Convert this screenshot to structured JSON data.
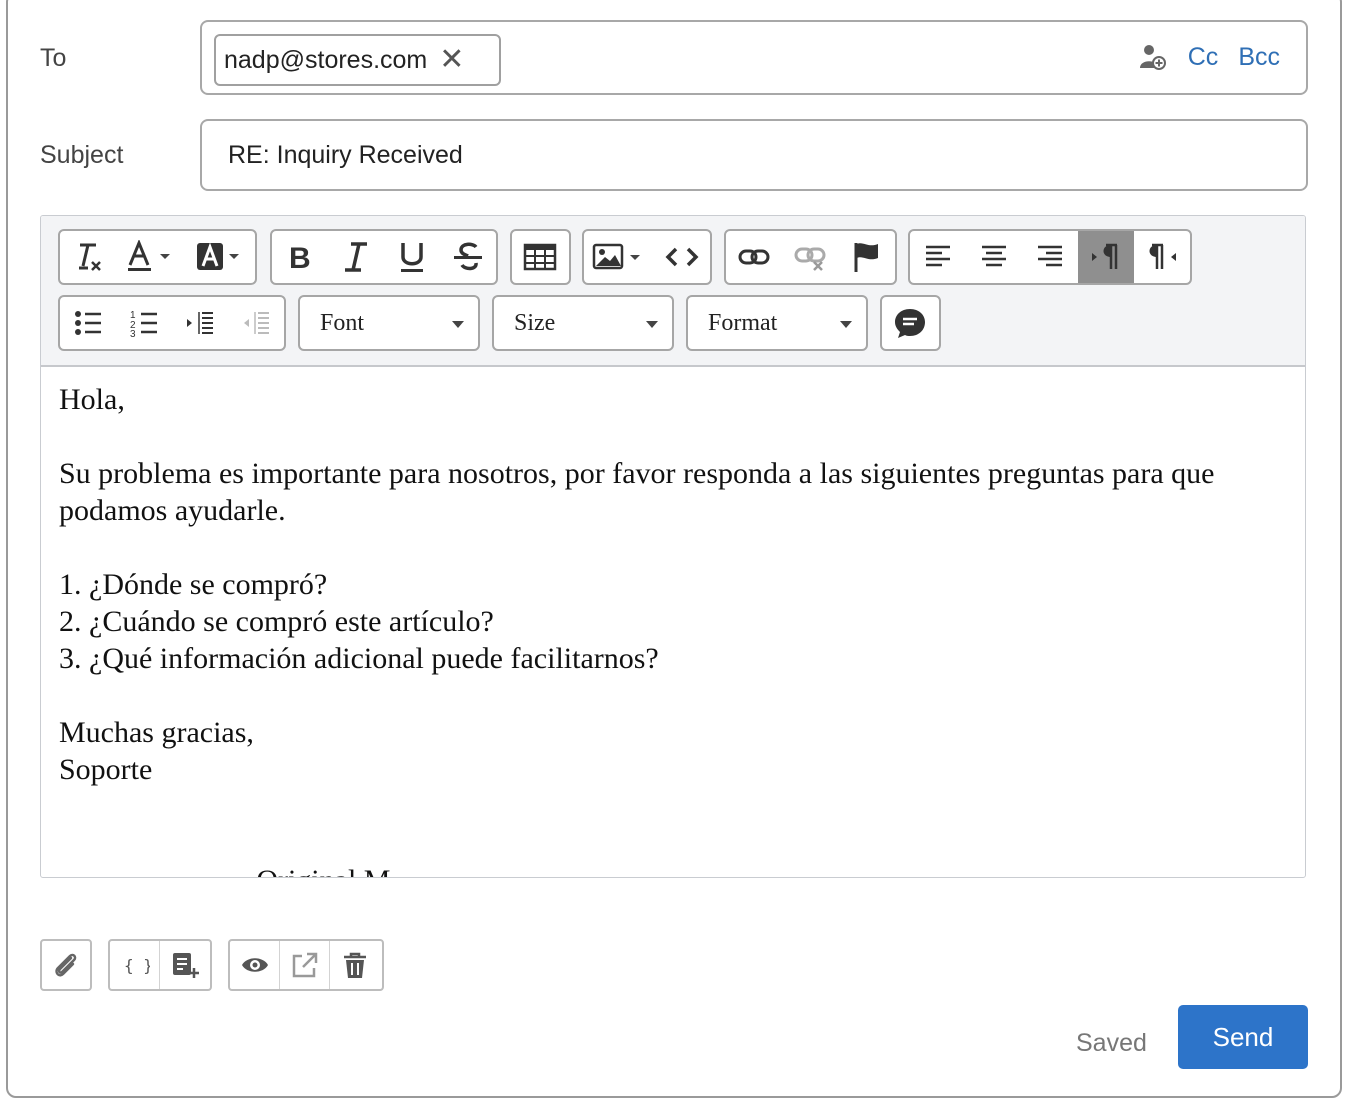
{
  "to": {
    "label": "To",
    "recipient": "nadp@stores.com",
    "remove_symbol": "✕",
    "cc_label": "Cc",
    "bcc_label": "Bcc"
  },
  "subject": {
    "label": "Subject",
    "value": "RE: Inquiry Received"
  },
  "toolbar": {
    "font_label": "Font",
    "size_label": "Size",
    "format_label": "Format",
    "active_button": "ltr-direction"
  },
  "message": {
    "greeting": "Hola,",
    "paragraph": "Su problema es importante para nosotros, por favor responda a las siguientes preguntas para que podamos ayudarle.",
    "q1": "1. ¿Dónde se compró?",
    "q2": "2. ¿Cuándo se compró este artículo?",
    "q3": "3. ¿Qué información adicional puede facilitarnos?",
    "closing": "Muchas gracias,",
    "signature": "Soporte",
    "cut_off_line": "------------------- Original M"
  },
  "footer": {
    "status": "Saved",
    "send_label": "Send"
  },
  "colors": {
    "accent": "#2d74c9",
    "link": "#2f6fb5",
    "toolbar_bg": "#f3f4f6",
    "pressed": "#8f8f8f"
  }
}
